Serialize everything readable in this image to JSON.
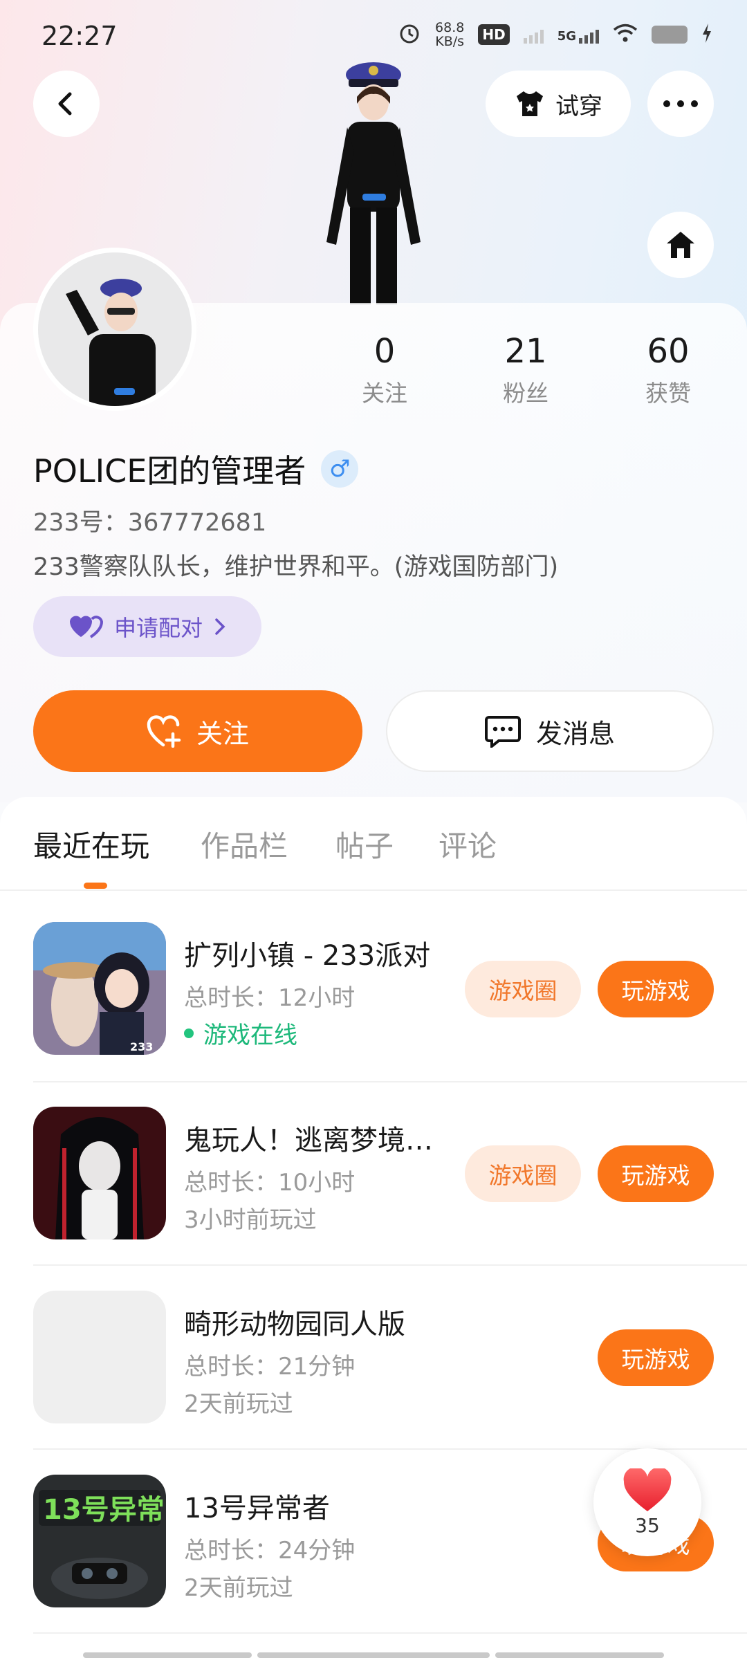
{
  "status_bar": {
    "time": "22:27",
    "net_speed_value": "68.8",
    "net_speed_unit": "KB/s",
    "hd_label": "HD",
    "network_type": "5G"
  },
  "header": {
    "try_on_label": "试穿"
  },
  "profile": {
    "stats": [
      {
        "value": "0",
        "label": "关注"
      },
      {
        "value": "21",
        "label": "粉丝"
      },
      {
        "value": "60",
        "label": "获赞"
      }
    ],
    "name": "POLICE团的管理者",
    "gender_symbol": "♂",
    "uid": "233号：367772681",
    "bio": "233警察队队长，维护世界和平。(游戏国防部门)",
    "pair_label": "申请配对",
    "follow_label": "关注",
    "message_label": "发消息"
  },
  "tabs": [
    {
      "label": "最近在玩",
      "active": true
    },
    {
      "label": "作品栏",
      "active": false
    },
    {
      "label": "帖子",
      "active": false
    },
    {
      "label": "评论",
      "active": false
    }
  ],
  "games": [
    {
      "title": "扩列小镇 - 233派对",
      "duration": "总时长：12小时",
      "sub": "游戏在线",
      "online": true,
      "circle_label": "游戏圈",
      "play_label": "玩游戏",
      "icon_badge": "233"
    },
    {
      "title": "鬼玩人！逃离梦境…",
      "duration": "总时长：10小时",
      "sub": "3小时前玩过",
      "online": false,
      "circle_label": "游戏圈",
      "play_label": "玩游戏"
    },
    {
      "title": "畸形动物园同人版",
      "duration": "总时长：21分钟",
      "sub": "2天前玩过",
      "online": false,
      "play_label": "玩游戏"
    },
    {
      "title": "13号异常者",
      "duration": "总时长：24分钟",
      "sub": "2天前玩过",
      "online": false,
      "play_label": "玩游戏",
      "icon_text": "13号异常"
    }
  ],
  "like_bubble": {
    "count": "35"
  },
  "colors": {
    "accent": "#fb7518",
    "online_green": "#1cb87a",
    "pair_purple": "#6b53c9"
  }
}
